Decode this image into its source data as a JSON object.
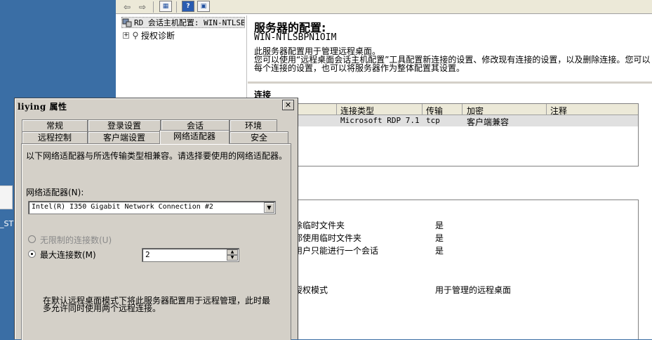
{
  "desktop": {
    "icon_label": "_ST"
  },
  "toolbar": {
    "back_glyph": "⇦",
    "forward_glyph": "⇨",
    "view_glyph": "▦",
    "help_glyph": "?",
    "panel_glyph": "▣",
    "icons": [
      "back-arrow-icon",
      "forward-arrow-icon",
      "console-view-icon",
      "help-icon",
      "show-pane-icon"
    ]
  },
  "tree": {
    "root_label": "RD 会话主机配置: WIN-NTLSB",
    "child_label": "授权诊断",
    "expander_glyph": "+"
  },
  "content": {
    "title": "服务器的配置:",
    "server_name": "WIN-NTLSBPN1OIM",
    "desc_line1": "此服务器配置用于管理远程桌面。",
    "desc_line2": "您可以使用“远程桌面会话主机配置”工具配置新连接的设置、修改现有连接的设置，以及删除连接。您可以",
    "desc_line3": "每个连接的设置，也可以将服务器作为整体配置其设置。",
    "connections_heading": "连接",
    "table": {
      "headers": [
        "连接类型",
        "传输",
        "加密",
        "注释"
      ],
      "row": {
        "type": "Microsoft RDP 7.1",
        "transport": "tcp",
        "encryption": "客户端兼容",
        "comment": ""
      }
    },
    "settings": [
      {
        "name": "删除临时文件夹",
        "value": "是"
      },
      {
        "name": "话都使用临时文件夹",
        "value": "是"
      },
      {
        "name": "个用户只能进行一个会话",
        "value": "是"
      },
      {
        "name": "面授权模式",
        "value": "用于管理的远程桌面"
      }
    ]
  },
  "dialog": {
    "title": "liying 属性",
    "close_glyph": "✕",
    "tabs_row1": [
      "常规",
      "登录设置",
      "会话",
      "环境"
    ],
    "tabs_row2": [
      "远程控制",
      "客户端设置",
      "网络适配器",
      "安全"
    ],
    "active_tab": "网络适配器",
    "description": "以下网络适配器与所选传输类型相兼容。请选择要使用的网络适配器。",
    "adapter_label": "网络适配器(N):",
    "adapter_value": "Intel(R) I350 Gigabit Network Connection #2",
    "unlimited_label": "无限制的连接数(U)",
    "unlimited_selected": false,
    "max_label": "最大连接数(M)",
    "max_selected": true,
    "max_value": "2",
    "footer_note": "在默认远程桌面模式下将此服务器配置用于远程管理，此时最多允许同时使用两个远程连接。"
  }
}
